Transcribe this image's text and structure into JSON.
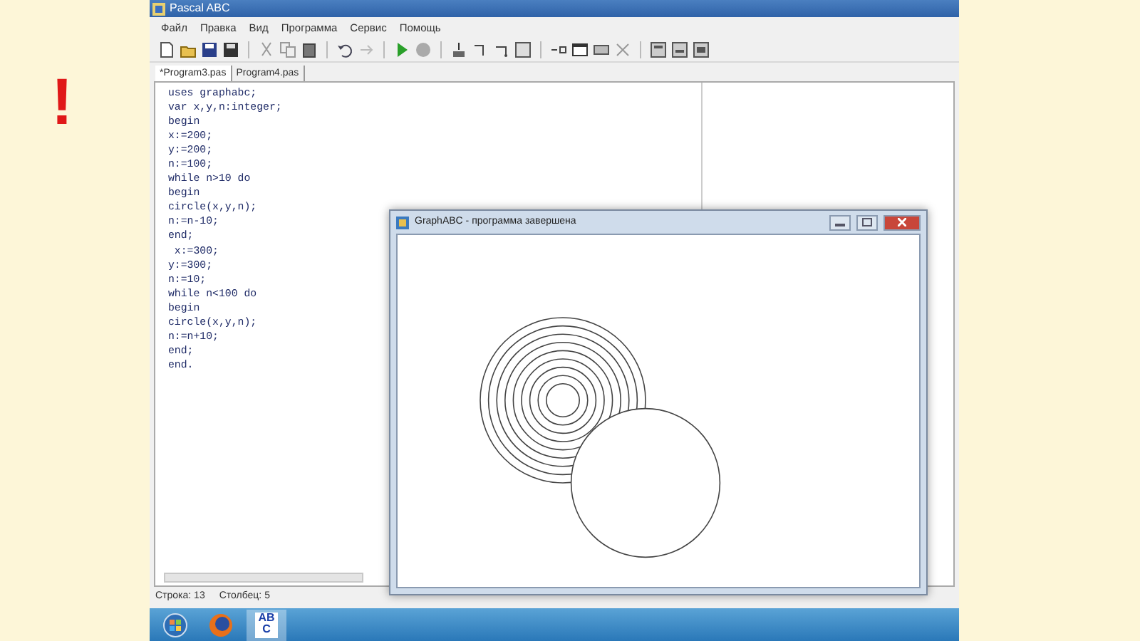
{
  "slide_mark": "!",
  "window": {
    "title": "Pascal ABC"
  },
  "menu": [
    "Файл",
    "Правка",
    "Вид",
    "Программа",
    "Сервис",
    "Помощь"
  ],
  "tabs": [
    {
      "label": "*Program3.pas",
      "selected": true
    },
    {
      "label": "Program4.pas",
      "selected": false
    }
  ],
  "code_lines": [
    "uses graphabc;",
    "var x,y,n:integer;",
    "begin",
    "x:=200;",
    "y:=200;",
    "n:=100;",
    "while n>10 do",
    "begin",
    "circle(x,y,n);",
    "n:=n-10;",
    "end;",
    " x:=300;",
    "y:=300;",
    "n:=10;",
    "while n<100 do",
    "begin",
    "circle(x,y,n);",
    "n:=n+10;",
    "end;",
    "end."
  ],
  "status_bar": [
    "Строка: 13",
    "Столбец: 5"
  ],
  "graph_window": {
    "title": "GraphABC - программа завершена"
  },
  "taskbar": {
    "app_letters": [
      "AB",
      "C"
    ]
  }
}
